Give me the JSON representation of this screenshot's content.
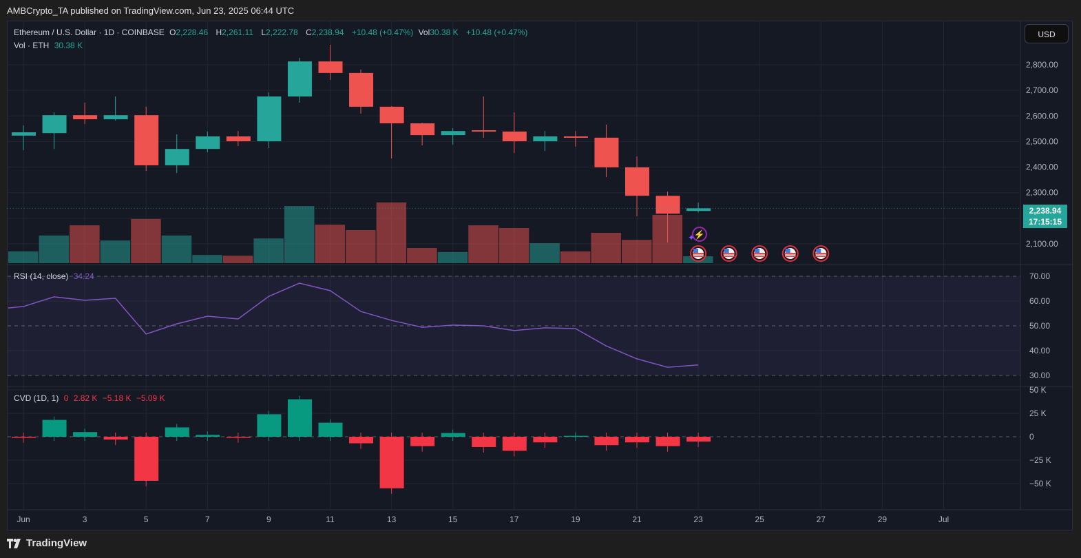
{
  "publish_line": "AMBCrypto_TA published on TradingView.com, Jun 23, 2025 06:44 UTC",
  "legend": {
    "symbol": "Ethereum / U.S. Dollar · 1D · COINBASE",
    "o_label": "O",
    "o": "2,228.46",
    "h_label": "H",
    "h": "2,261.11",
    "l_label": "L",
    "l": "2,222.78",
    "c_label": "C",
    "c": "2,238.94",
    "change": "+10.48 (+0.47%)",
    "vol_label": "Vol",
    "vol": "30.38 K",
    "change2": "+10.48 (+0.47%)",
    "vol_pane_label": "Vol · ETH",
    "vol_pane_value": "30.38 K",
    "rsi_label": "RSI (14, close)",
    "rsi_value": "34.24",
    "cvd_label": "CVD (1D, 1)",
    "cvd_values": [
      "0",
      "2.82 K",
      "−5.18 K",
      "−5.09 K"
    ]
  },
  "currency_button": "USD",
  "last_price": {
    "price": "2,238.94",
    "countdown": "17:15:15"
  },
  "footer_brand": "TradingView",
  "colors": {
    "up": "#26a69a",
    "down": "#ef5350",
    "cvd_up": "#089981",
    "cvd_down": "#f23645",
    "rsi": "#7e57c2"
  },
  "chart_data": [
    {
      "type": "candlestick",
      "title": "Ethereum / U.S. Dollar · 1D · COINBASE",
      "x_tick_labels": [
        {
          "day": 1,
          "label": "Jun"
        },
        {
          "day": 3,
          "label": "3"
        },
        {
          "day": 5,
          "label": "5"
        },
        {
          "day": 7,
          "label": "7"
        },
        {
          "day": 9,
          "label": "9"
        },
        {
          "day": 11,
          "label": "11"
        },
        {
          "day": 13,
          "label": "13"
        },
        {
          "day": 15,
          "label": "15"
        },
        {
          "day": 17,
          "label": "17"
        },
        {
          "day": 19,
          "label": "19"
        },
        {
          "day": 21,
          "label": "21"
        },
        {
          "day": 23,
          "label": "23"
        },
        {
          "day": 25,
          "label": "25"
        },
        {
          "day": 27,
          "label": "27"
        },
        {
          "day": 29,
          "label": "29"
        },
        {
          "day": 31,
          "label": "Jul"
        }
      ],
      "y_tick_labels": [
        "2,800.00",
        "2,700.00",
        "2,600.00",
        "2,500.00",
        "2,400.00",
        "2,300.00",
        "2,100.00"
      ],
      "y_ticks": [
        2800,
        2700,
        2600,
        2500,
        2400,
        2300,
        2100
      ],
      "ylim": [
        2080,
        2900
      ],
      "grid": true,
      "candles": [
        {
          "day": 1,
          "o": 2523,
          "h": 2563,
          "l": 2466,
          "c": 2536
        },
        {
          "day": 2,
          "o": 2533,
          "h": 2614,
          "l": 2471,
          "c": 2603
        },
        {
          "day": 3,
          "o": 2603,
          "h": 2652,
          "l": 2568,
          "c": 2587
        },
        {
          "day": 4,
          "o": 2587,
          "h": 2676,
          "l": 2582,
          "c": 2603
        },
        {
          "day": 5,
          "o": 2603,
          "h": 2636,
          "l": 2385,
          "c": 2407
        },
        {
          "day": 6,
          "o": 2407,
          "h": 2528,
          "l": 2377,
          "c": 2471
        },
        {
          "day": 7,
          "o": 2471,
          "h": 2539,
          "l": 2458,
          "c": 2520
        },
        {
          "day": 8,
          "o": 2520,
          "h": 2541,
          "l": 2482,
          "c": 2501
        },
        {
          "day": 9,
          "o": 2501,
          "h": 2692,
          "l": 2474,
          "c": 2676
        },
        {
          "day": 10,
          "o": 2676,
          "h": 2827,
          "l": 2652,
          "c": 2813
        },
        {
          "day": 11,
          "o": 2813,
          "h": 2878,
          "l": 2741,
          "c": 2768
        },
        {
          "day": 12,
          "o": 2768,
          "h": 2781,
          "l": 2609,
          "c": 2636
        },
        {
          "day": 13,
          "o": 2636,
          "h": 2638,
          "l": 2434,
          "c": 2571
        },
        {
          "day": 14,
          "o": 2571,
          "h": 2573,
          "l": 2485,
          "c": 2525
        },
        {
          "day": 15,
          "o": 2525,
          "h": 2552,
          "l": 2488,
          "c": 2541
        },
        {
          "day": 16,
          "o": 2544,
          "h": 2676,
          "l": 2515,
          "c": 2539
        },
        {
          "day": 17,
          "o": 2539,
          "h": 2614,
          "l": 2455,
          "c": 2501
        },
        {
          "day": 18,
          "o": 2501,
          "h": 2541,
          "l": 2463,
          "c": 2520
        },
        {
          "day": 19,
          "o": 2520,
          "h": 2541,
          "l": 2480,
          "c": 2515
        },
        {
          "day": 20,
          "o": 2515,
          "h": 2566,
          "l": 2361,
          "c": 2399
        },
        {
          "day": 21,
          "o": 2399,
          "h": 2442,
          "l": 2208,
          "c": 2288
        },
        {
          "day": 22,
          "o": 2288,
          "h": 2304,
          "l": 2105,
          "c": 2218
        },
        {
          "day": 23,
          "o": 2228.46,
          "h": 2261.11,
          "l": 2222.78,
          "c": 2238.94
        }
      ],
      "volume_k": [
        52,
        122,
        167,
        100,
        195,
        122,
        36,
        33,
        109,
        252,
        170,
        146,
        268,
        67,
        49,
        167,
        155,
        88,
        52,
        134,
        103,
        213,
        30.38
      ],
      "event_markers": [
        {
          "day": 23,
          "icon": "us-flag-icon"
        },
        {
          "day": 24,
          "icon": "us-flag-icon"
        },
        {
          "day": 25,
          "icon": "us-flag-icon"
        },
        {
          "day": 26,
          "icon": "us-flag-icon"
        },
        {
          "day": 27,
          "icon": "us-flag-icon"
        }
      ]
    },
    {
      "type": "line",
      "title": "RSI (14, close)",
      "y_tick_labels": [
        "70.00",
        "60.00",
        "50.00",
        "40.00",
        "30.00"
      ],
      "y_ticks": [
        70,
        60,
        50,
        40,
        30
      ],
      "ylim": [
        30,
        70
      ],
      "days": [
        1,
        2,
        3,
        4,
        5,
        6,
        7,
        8,
        9,
        10,
        11,
        12,
        13,
        14,
        15,
        16,
        17,
        18,
        19,
        20,
        21,
        22,
        23
      ],
      "values": [
        57.8,
        61.7,
        60.3,
        61.1,
        46.7,
        50.8,
        53.9,
        52.8,
        61.9,
        67.2,
        64.2,
        55.8,
        52.2,
        49.4,
        50.3,
        50.0,
        48.1,
        49.2,
        48.9,
        41.9,
        36.7,
        33.3,
        34.24
      ]
    },
    {
      "type": "bar",
      "title": "CVD (1D, 1)",
      "y_tick_labels": [
        "50 K",
        "25 K",
        "0",
        "−25 K",
        "−50 K"
      ],
      "y_ticks": [
        50,
        25,
        0,
        -25,
        -50
      ],
      "unit": "K",
      "days": [
        1,
        2,
        3,
        4,
        5,
        6,
        7,
        8,
        9,
        10,
        11,
        12,
        13,
        14,
        15,
        16,
        17,
        18,
        19,
        20,
        21,
        22,
        23
      ],
      "values": [
        -0.5,
        18,
        5,
        -3,
        -47,
        10,
        2,
        -0.5,
        24,
        40,
        15,
        -7,
        -55,
        -10,
        4,
        -11,
        -15,
        -6,
        1,
        -9,
        -6,
        -10,
        -5.09
      ]
    }
  ]
}
